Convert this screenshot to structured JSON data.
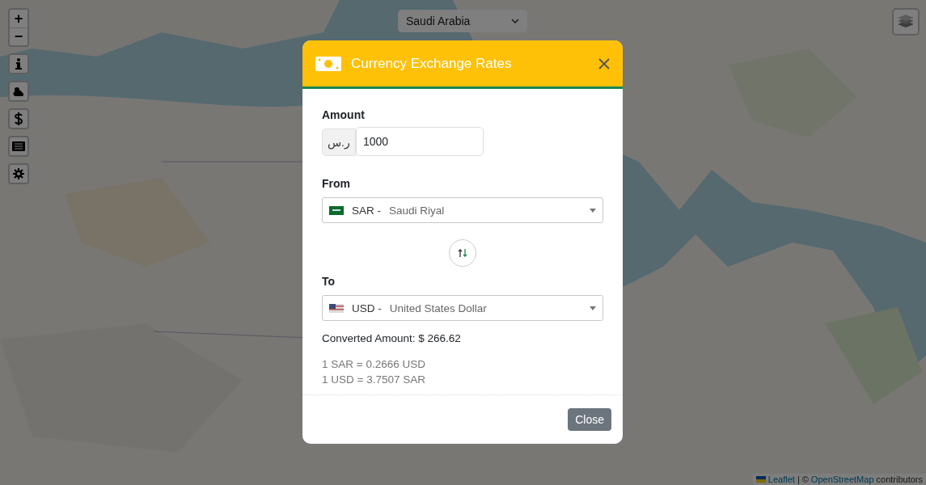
{
  "zoom_controls": [
    {
      "label": "+"
    },
    {
      "label": "−"
    }
  ],
  "country_select": {
    "value": "Saudi Arabia"
  },
  "attribution": {
    "link_1": "Leaflet",
    "separator": "|",
    "copyright": "©",
    "link_2": "OpenStreetMap",
    "suffix": "contributors"
  },
  "modal": {
    "title": "Currency Exchange Rates",
    "amount": {
      "label": "Amount",
      "symbol": "ر.س",
      "value": "1000"
    },
    "from": {
      "label": "From",
      "code": "SAR",
      "dash": "-",
      "name": "Saudi Riyal",
      "kind": "sa"
    },
    "to": {
      "label": "To",
      "code": "USD",
      "dash": "-",
      "name": "United States Dollar",
      "kind": "us"
    },
    "converted": "Converted Amount: $ 266.62",
    "rates": [
      "1 SAR = 0.2666 USD",
      "1 USD = 3.7507 SAR"
    ],
    "close_button": "Close"
  }
}
